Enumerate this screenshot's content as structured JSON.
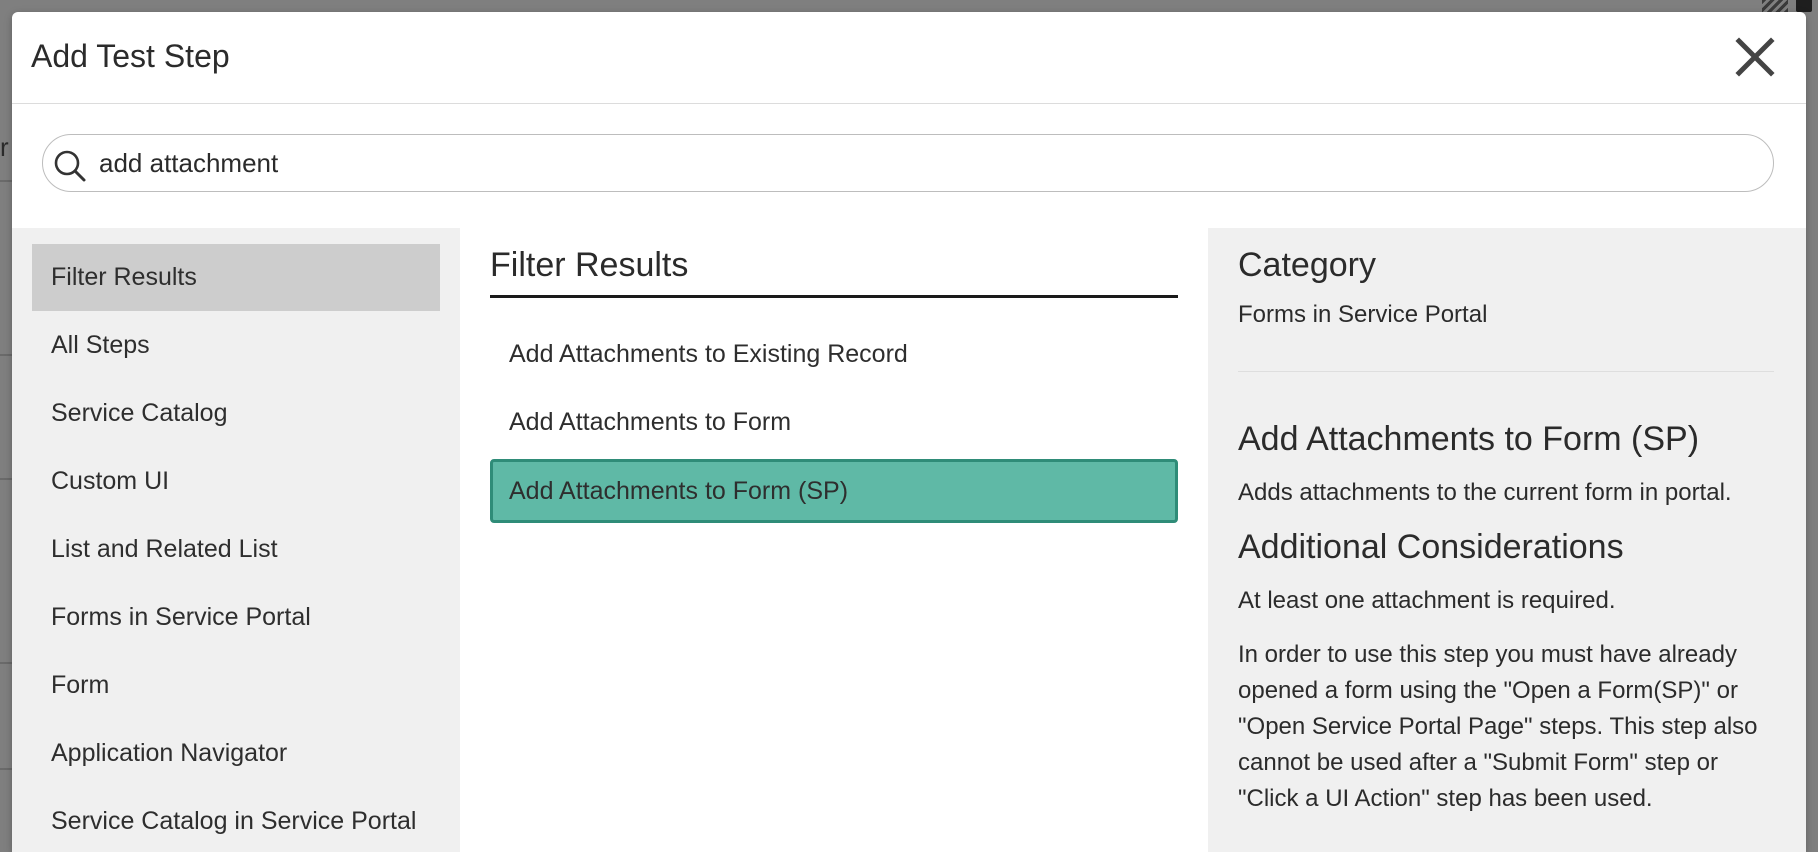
{
  "dialog": {
    "title": "Add Test Step",
    "close_label": "Close"
  },
  "search": {
    "value": "add attachment",
    "placeholder": "Search"
  },
  "categories": [
    {
      "label": "Filter Results",
      "active": true
    },
    {
      "label": "All Steps"
    },
    {
      "label": "Service Catalog"
    },
    {
      "label": "Custom UI"
    },
    {
      "label": "List and Related List"
    },
    {
      "label": "Forms in Service Portal"
    },
    {
      "label": "Form"
    },
    {
      "label": "Application Navigator"
    },
    {
      "label": "Service Catalog in Service Portal"
    }
  ],
  "results": {
    "heading": "Filter Results",
    "items": [
      {
        "label": "Add Attachments to Existing Record"
      },
      {
        "label": "Add Attachments to Form"
      },
      {
        "label": "Add Attachments to Form (SP)",
        "selected": true
      }
    ]
  },
  "details": {
    "category_heading": "Category",
    "category_value": "Forms in Service Portal",
    "step_title": "Add Attachments to Form (SP)",
    "step_description": "Adds attachments to the current form in portal.",
    "considerations_heading": "Additional Considerations",
    "consideration_1": "At least one attachment is required.",
    "consideration_2": "In order to use this step you must have already opened a form using the \"Open a Form(SP)\" or \"Open Service Portal Page\" steps. This step also cannot be used after a \"Submit Form\" step or \"Click a UI Action\" step has been used."
  },
  "colors": {
    "selected_fill": "#5fb9a6",
    "selected_border": "#2f8c78",
    "panel_bg": "#f0f0f0",
    "active_category_bg": "#cdcdcd"
  },
  "icons": {
    "search": "search-icon",
    "close": "close-icon"
  }
}
